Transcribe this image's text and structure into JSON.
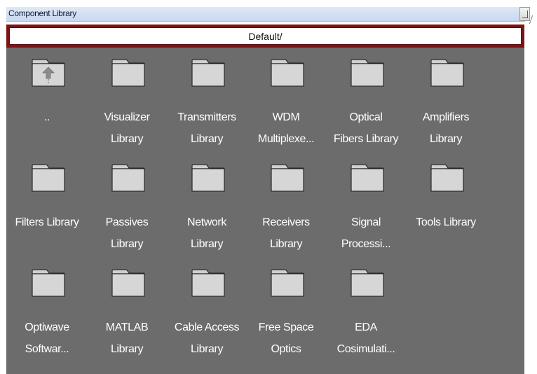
{
  "window": {
    "title": "Component Library"
  },
  "path": {
    "value": "Default/"
  },
  "items": [
    {
      "label": "..",
      "icon": "folder-up-icon"
    },
    {
      "label": "Visualizer\nLibrary",
      "icon": "folder-icon"
    },
    {
      "label": "Transmitters\nLibrary",
      "icon": "folder-icon"
    },
    {
      "label": "WDM\nMultiplexe...",
      "icon": "folder-icon"
    },
    {
      "label": "Optical\nFibers Library",
      "icon": "folder-icon"
    },
    {
      "label": "Amplifiers\nLibrary",
      "icon": "folder-icon"
    },
    {
      "label": "Filters Library",
      "icon": "folder-icon"
    },
    {
      "label": "Passives\nLibrary",
      "icon": "folder-icon"
    },
    {
      "label": "Network\nLibrary",
      "icon": "folder-icon"
    },
    {
      "label": "Receivers\nLibrary",
      "icon": "folder-icon"
    },
    {
      "label": "Signal\nProcessi...",
      "icon": "folder-icon"
    },
    {
      "label": "Tools Library",
      "icon": "folder-icon"
    },
    {
      "label": "Optiwave\nSoftwar...",
      "icon": "folder-icon"
    },
    {
      "label": "MATLAB\nLibrary",
      "icon": "folder-icon"
    },
    {
      "label": "Cable Access\nLibrary",
      "icon": "folder-icon"
    },
    {
      "label": "Free Space\nOptics",
      "icon": "folder-icon"
    },
    {
      "label": "EDA\nCosimulati...",
      "icon": "folder-icon"
    }
  ],
  "colors": {
    "panel_background": "#6c6c6c",
    "path_border": "#7d1416",
    "folder_fill": "#d4d4d4",
    "label_text": "#ffffff"
  }
}
